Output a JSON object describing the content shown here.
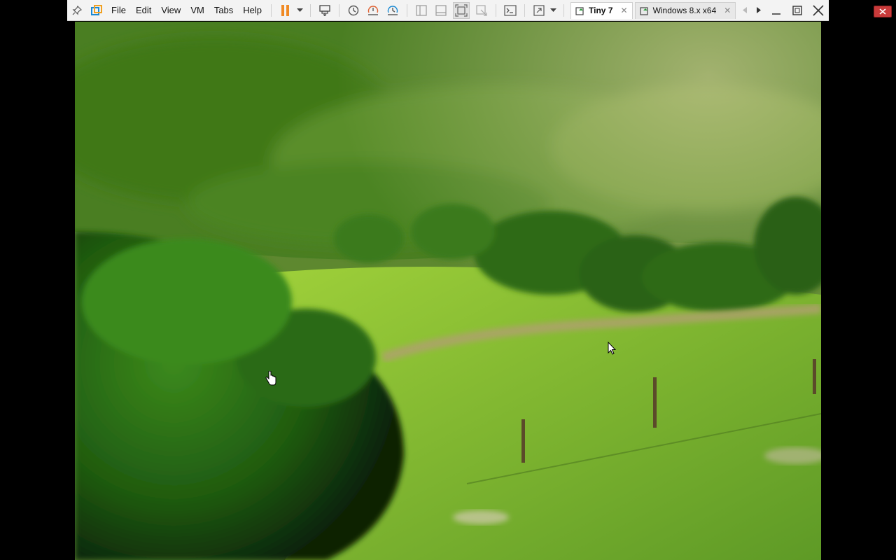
{
  "menu": {
    "file": "File",
    "edit": "Edit",
    "view": "View",
    "vm": "VM",
    "tabs": "Tabs",
    "help": "Help"
  },
  "tabs": [
    {
      "label": "Tiny 7",
      "active": true
    },
    {
      "label": "Windows 8.x x64",
      "active": false
    }
  ],
  "icons": {
    "pin": "pin-icon",
    "vmware": "vmware-logo-icon",
    "pause": "pause-icon",
    "send_keys": "send-ctrl-alt-del-icon",
    "snapshot": "snapshot-icon",
    "revert": "revert-snapshot-icon",
    "snapshot_manager": "snapshot-manager-icon",
    "console": "console-view-icon",
    "fullscreen": "fullscreen-icon"
  },
  "colors": {
    "pause_accent": "#f08a24",
    "close_red": "#c93b3b"
  }
}
